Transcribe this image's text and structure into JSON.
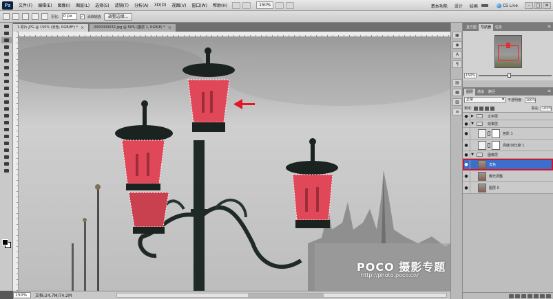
{
  "menubar": {
    "logo": "Ps",
    "items": [
      "文件(F)",
      "编辑(E)",
      "图像(I)",
      "图层(L)",
      "选择(S)",
      "滤镜(T)",
      "分析(A)",
      "3D(D)",
      "视图(V)",
      "窗口(W)",
      "帮助(H)"
    ],
    "zoom": "150%",
    "workspaces": [
      "基本功能",
      "设计",
      "绘画"
    ],
    "workspace_active": "",
    "cs_live": "CS Live",
    "window_buttons": [
      "–",
      "□",
      "✕"
    ]
  },
  "options": {
    "feather_label": "羽化:",
    "feather_value": "0 px",
    "antialias_mark": "✓",
    "antialias_label": "消除锯齿",
    "refine_edge": "调整边缘..."
  },
  "tabs": [
    {
      "label": "1.原片.JPG @ 150% (去色, RGB/8*) *",
      "close": "×"
    },
    {
      "label": "0000000032.jpg @ 50% (图层 1, RGB/8) *",
      "close": "×"
    }
  ],
  "status": {
    "zoom": "150%",
    "doc_label": "文档:24.7M/74.2M"
  },
  "watermark": {
    "brand": "POCO 摄影专题",
    "url": "http://photo.poco.cn/"
  },
  "strip_icons": [
    "▣",
    "◉",
    "A",
    "¶",
    "▤",
    "▦",
    "▧",
    "≡"
  ],
  "navigator": {
    "tabs": [
      "直方图",
      "导航器",
      "信息"
    ],
    "active_tab": 1,
    "zoom": "150%",
    "menu": "≡"
  },
  "layers_panel": {
    "tabs": [
      "图层",
      "通道",
      "路径"
    ],
    "blend_mode": "正常",
    "opacity_label": "不透明度:",
    "opacity": "100%",
    "lock_label": "锁定:",
    "fill_label": "填充:",
    "fill": "100%",
    "eye": "●",
    "collapsed": "▶",
    "expanded": "▼",
    "layers": [
      {
        "name": "文字层",
        "kind": "group",
        "expanded": false,
        "indent": 0
      },
      {
        "name": "效果层",
        "kind": "group",
        "expanded": true,
        "indent": 0
      },
      {
        "name": "色阶 1",
        "kind": "adjustment",
        "indent": 1
      },
      {
        "name": "亮度/对比度 1",
        "kind": "adjustment",
        "indent": 1
      },
      {
        "name": "图像层",
        "kind": "group",
        "expanded": true,
        "indent": 0
      },
      {
        "name": "去色",
        "kind": "photo",
        "indent": 1,
        "selected": true
      },
      {
        "name": "曝光调整",
        "kind": "photo",
        "indent": 1
      },
      {
        "name": "图层 0",
        "kind": "photo",
        "indent": 1
      }
    ]
  },
  "colors": {
    "selected_layer": "#3c6fcb",
    "highlight_border": "#d3142b",
    "arrow": "#e0182a",
    "lamp_glass": "#e0485a"
  }
}
